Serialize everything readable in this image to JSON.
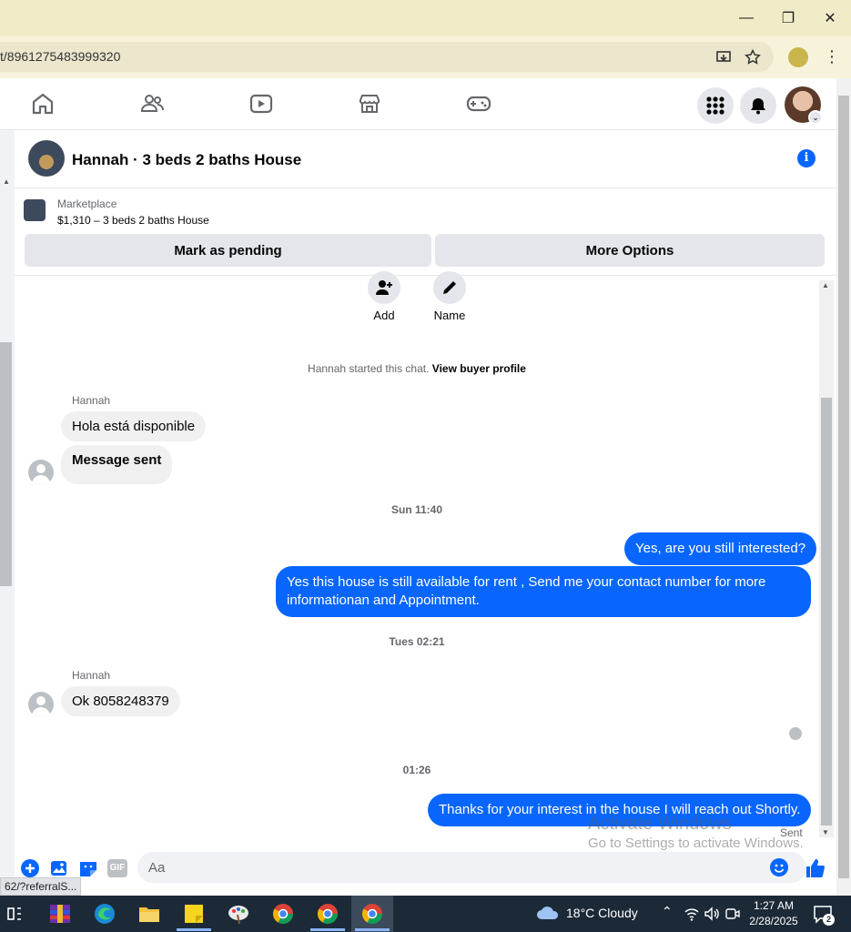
{
  "browser": {
    "url": "t/8961275483999320",
    "status_url": "62/?referralS..."
  },
  "nav": {
    "icons": [
      "home-icon",
      "friends-icon",
      "watch-icon",
      "marketplace-icon",
      "gaming-icon"
    ],
    "right_icons": [
      "menu-grid-icon",
      "notifications-icon"
    ]
  },
  "chat": {
    "title": "Hannah · 3 beds 2 baths House",
    "marketplace_label": "Marketplace",
    "listing": "$1,310 – 3 beds 2 baths House",
    "pending_button": "Mark as pending",
    "more_button": "More Options"
  },
  "actions": {
    "add": "Add",
    "name": "Name"
  },
  "thread": {
    "started_text": "Hannah started this chat.",
    "view_profile": "View buyer profile",
    "sender1": "Hannah",
    "msg1": "Hola está disponible",
    "msg2": "Message sent",
    "stamp1": "Sun 11:40",
    "out1": "Yes, are you still interested?",
    "out2": "Yes this house is still available for rent , Send me your contact number for more informationan and Appointment.",
    "stamp2": "Tues 02:21",
    "sender2": "Hannah",
    "msg3": "Ok 8058248379",
    "stamp3": "01:26",
    "out3": "Thanks for your interest in the house I will reach out Shortly.",
    "sent_label": "Sent"
  },
  "composer": {
    "placeholder": "Aa",
    "gif_label": "GIF"
  },
  "watermark": {
    "line1": "Activate Windows",
    "line2": "Go to Settings to activate Windows."
  },
  "taskbar": {
    "weather": "18°C  Cloudy",
    "time": "1:27 AM",
    "date": "2/28/2025",
    "notif_count": "2"
  },
  "colors": {
    "accent": "#0866ff",
    "bubble_in": "#f0f0f0",
    "taskbar": "#1c2a38"
  }
}
